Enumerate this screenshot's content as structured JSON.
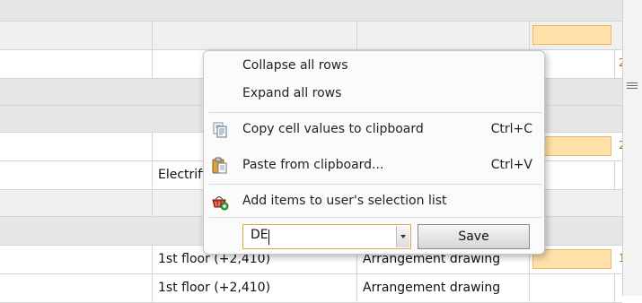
{
  "grid": {
    "rows": [
      {
        "kind": "group"
      },
      {
        "kind": "subhdr"
      },
      {
        "kind": "data"
      },
      {
        "kind": "group"
      },
      {
        "kind": "group"
      },
      {
        "kind": "data"
      },
      {
        "kind": "data",
        "c2": "Electrifi"
      },
      {
        "kind": "subhdr"
      },
      {
        "kind": "group"
      },
      {
        "kind": "data",
        "c1": "1st floor (+2,410)",
        "c2": "Arrangement drawing"
      },
      {
        "kind": "data",
        "c1": "1st floor (+2,410)",
        "c2": "Arrangement drawing"
      }
    ],
    "edge_values": [
      "2",
      "2",
      "1"
    ]
  },
  "context_menu": {
    "collapse_all": "Collapse all rows",
    "expand_all": "Expand all rows",
    "copy_cells": "Copy cell values to clipboard",
    "copy_shortcut": "Ctrl+C",
    "paste": "Paste from clipboard...",
    "paste_shortcut": "Ctrl+V",
    "add_selection": "Add items to user's selection list",
    "combo_value": "DE",
    "save_label": "Save"
  },
  "icons": {
    "copy": "copy-icon",
    "paste": "clipboard-paste-icon",
    "add_selection": "basket-add-icon"
  },
  "colors": {
    "highlight_cell": "#ffe0a8",
    "combo_border": "#e0a44a"
  }
}
